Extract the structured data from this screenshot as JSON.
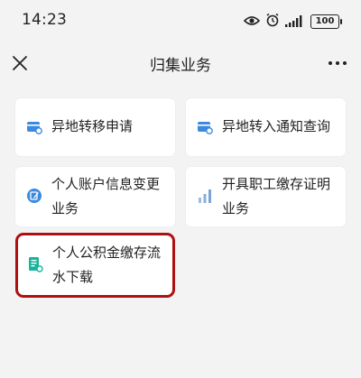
{
  "status_bar": {
    "time": "14:23",
    "battery": "100",
    "icons": [
      "eye-icon",
      "alarm-icon",
      "signal-icon",
      "battery-icon"
    ]
  },
  "nav": {
    "title": "归集业务",
    "close_icon": "close-icon",
    "more_icon": "more-icon"
  },
  "cards": [
    {
      "name": "card-remote-transfer-out",
      "label": "异地转移申请",
      "icon": "card-doc-icon",
      "color": "#3b8ae0"
    },
    {
      "name": "card-remote-transfer-in-query",
      "label": "异地转入通知查询",
      "icon": "card-doc-icon",
      "color": "#3b8ae0"
    },
    {
      "name": "card-account-info-change",
      "label": "个人账户信息变更业务",
      "icon": "edit-icon",
      "color": "#3b8ae0"
    },
    {
      "name": "card-employee-deposit-cert",
      "label": "开具职工缴存证明业务",
      "icon": "bar-chart-icon",
      "color": "#8ab0dc"
    },
    {
      "name": "card-fund-flow-download",
      "label": "个人公积金缴存流水下载",
      "icon": "statement-icon",
      "color": "#17b39a"
    }
  ],
  "colors": {
    "background": "#f3f3f3",
    "card": "#ffffff",
    "highlight_border": "#b00f0f"
  }
}
